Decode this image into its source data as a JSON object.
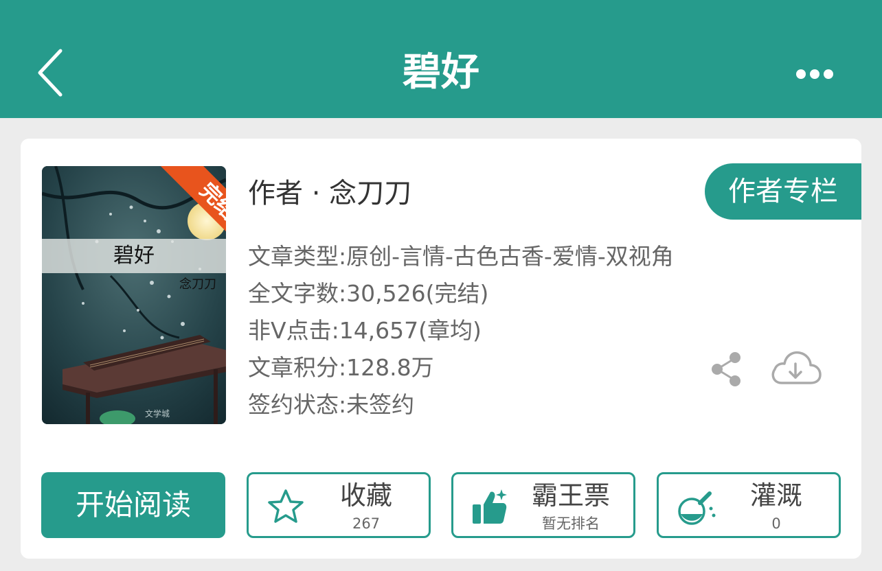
{
  "header": {
    "title": "碧好",
    "back_icon": "chevron-left-icon",
    "more_icon": "more-dots-icon"
  },
  "book": {
    "cover": {
      "title": "碧好",
      "author": "念刀刀",
      "ribbon": "完结",
      "publisher": "文学城"
    },
    "author_line": "作者 · 念刀刀",
    "author_column_button": "作者专栏",
    "info": {
      "genre": "文章类型:原创-言情-古色古香-爱情-双视角",
      "word_count": "全文字数:30,526(完结)",
      "clicks": "非Ⅴ点击:14,657(章均)",
      "score": "文章积分:128.8万",
      "sign_status": "签约状态:未签约"
    },
    "share_icon": "share-icon",
    "download_icon": "cloud-download-icon"
  },
  "actions": {
    "read": "开始阅读",
    "collect": {
      "label": "收藏",
      "count": "267",
      "icon": "star-icon"
    },
    "vote": {
      "label": "霸王票",
      "status": "暂无排名",
      "icon": "thumbs-up-icon"
    },
    "water": {
      "label": "灌溉",
      "count": "0",
      "icon": "flask-icon"
    }
  },
  "colors": {
    "primary": "#269b8c",
    "ribbon": "#e8541d",
    "background": "#ececec"
  }
}
